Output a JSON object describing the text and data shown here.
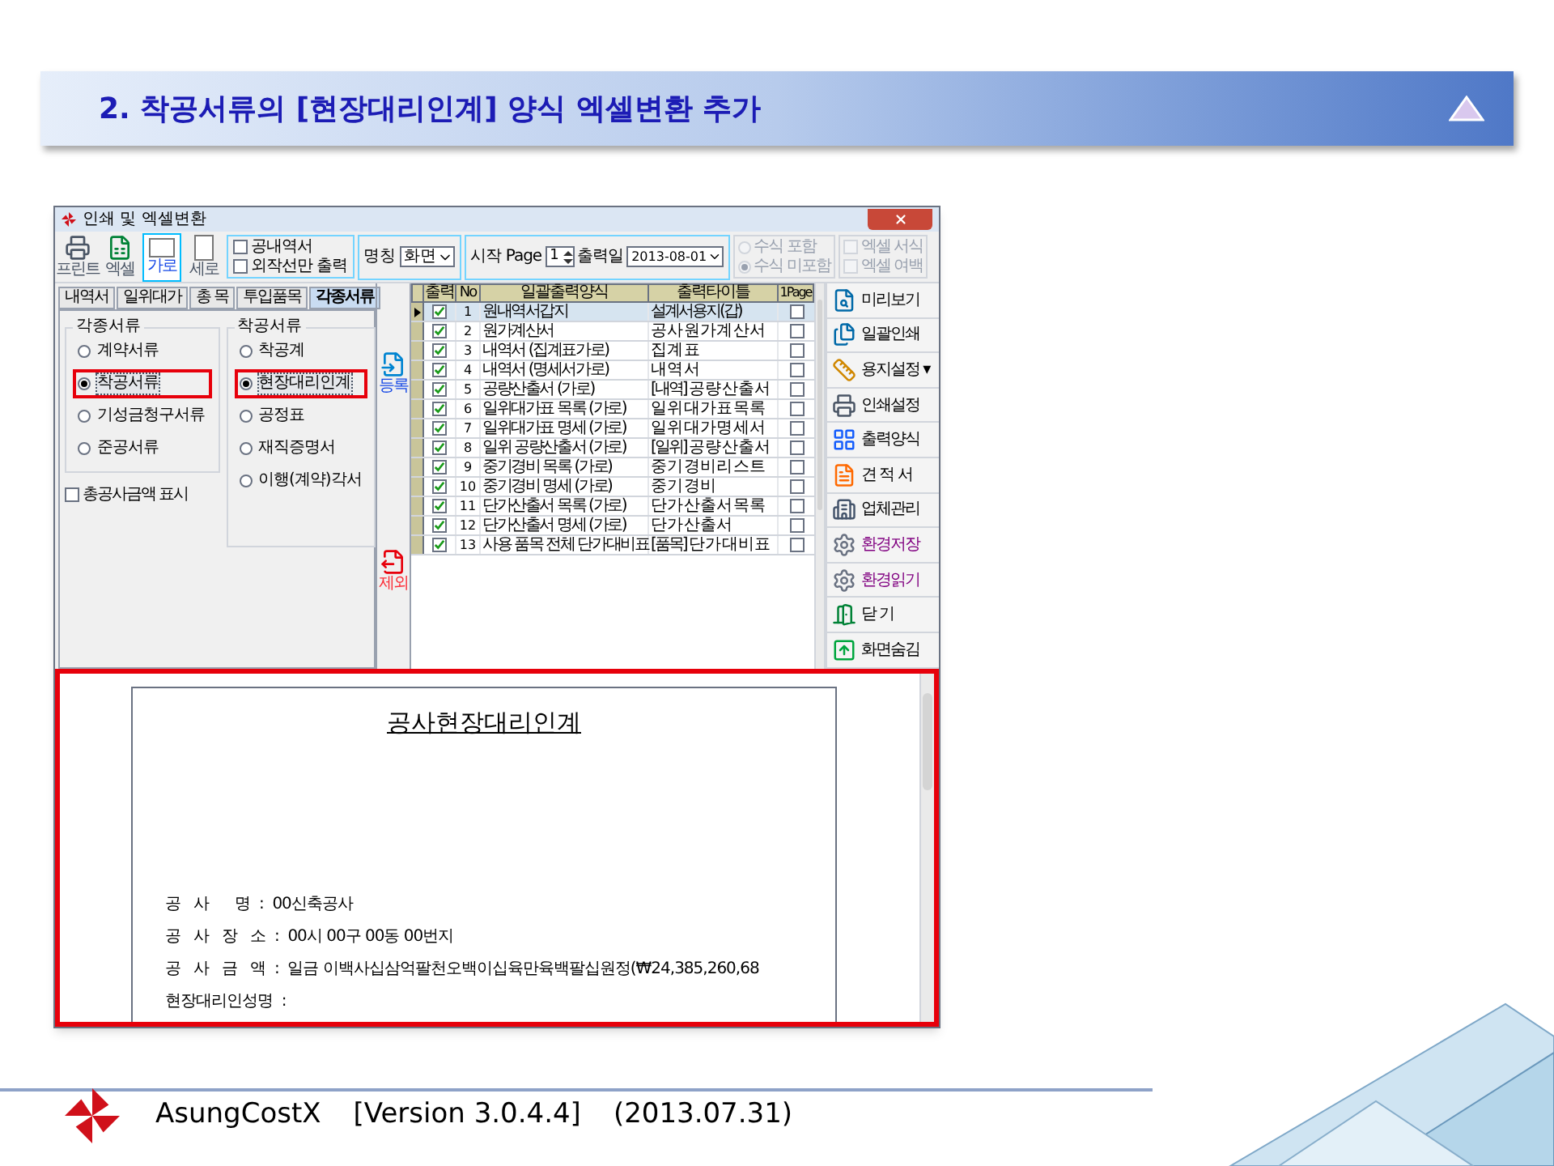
{
  "slide": {
    "title": "2. 착공서류의 [현장대리인계] 양식 엑셀변환 추가"
  },
  "window": {
    "title": "인쇄 및 엑셀변환"
  },
  "toolbar": {
    "buttons": [
      {
        "label": "프린트",
        "kind": "print",
        "selected": false
      },
      {
        "label": "엑셀",
        "kind": "excel",
        "selected": false
      },
      {
        "label": "가로",
        "kind": "landscape",
        "selected": true
      },
      {
        "label": "세로",
        "kind": "portrait",
        "selected": false
      }
    ],
    "options": [
      {
        "label": "공내역서",
        "checked": false
      },
      {
        "label": "외작선만 출력",
        "checked": false
      }
    ],
    "name_field": {
      "label": "명칭",
      "value": "화면"
    },
    "start_page": {
      "label": "시작 Page",
      "value": "1"
    },
    "print_date": {
      "label": "출력일",
      "value": "2013-08-01"
    },
    "formula": [
      {
        "label": "수식 포함",
        "selected": false,
        "disabled": true
      },
      {
        "label": "수식 미포함",
        "selected": true,
        "disabled": true
      }
    ],
    "excel_options": [
      {
        "label": "엑셀 서식",
        "checked": false,
        "disabled": true
      },
      {
        "label": "엑셀 여백",
        "checked": false,
        "disabled": true
      }
    ]
  },
  "tabs": [
    {
      "label": "내역서",
      "selected": false
    },
    {
      "label": "일위대가",
      "selected": false
    },
    {
      "label": "총 목",
      "selected": false
    },
    {
      "label": "투입품목",
      "selected": false
    },
    {
      "label": "각종서류",
      "selected": true
    }
  ],
  "doc_types": {
    "title": "각종서류",
    "options": [
      {
        "label": "계약서류",
        "selected": false,
        "highlighted": false
      },
      {
        "label": "착공서류",
        "selected": true,
        "highlighted": true
      },
      {
        "label": "기성금청구서류",
        "selected": false,
        "highlighted": false
      },
      {
        "label": "준공서류",
        "selected": false,
        "highlighted": false
      }
    ]
  },
  "total_amount": {
    "label": "총공사금액 표시",
    "checked": false
  },
  "start_docs": {
    "title": "착공서류",
    "options": [
      {
        "label": "착공계",
        "selected": false,
        "highlighted": false
      },
      {
        "label": "현장대리인계",
        "selected": true,
        "highlighted": true
      },
      {
        "label": "공정표",
        "selected": false,
        "highlighted": false
      },
      {
        "label": "재직증명서",
        "selected": false,
        "highlighted": false
      },
      {
        "label": "이행(계약)각서",
        "selected": false,
        "highlighted": false
      }
    ]
  },
  "add_button": {
    "label": "등록"
  },
  "remove_button": {
    "label": "제외"
  },
  "table": {
    "columns": [
      "출력",
      "No",
      "일괄출력양식",
      "출력타이틀",
      "1Page"
    ],
    "rows": [
      {
        "print": true,
        "no": "1",
        "form": "원내역서갑지",
        "title": "설계서용지(갑)",
        "one_page": false,
        "selected": true
      },
      {
        "print": true,
        "no": "2",
        "form": "원가계산서",
        "title": "공 사 원 가 계 산 서",
        "one_page": false,
        "selected": false
      },
      {
        "print": true,
        "no": "3",
        "form": "내역서 (집계표가로)",
        "title": "집 계 표",
        "one_page": false,
        "selected": false
      },
      {
        "print": true,
        "no": "4",
        "form": "내역서 (명세서가로)",
        "title": "내 역 서",
        "one_page": false,
        "selected": false
      },
      {
        "print": true,
        "no": "5",
        "form": "공량산출서 (가로)",
        "title": "[내역] 공 량 산 출 서",
        "one_page": false,
        "selected": false
      },
      {
        "print": true,
        "no": "6",
        "form": "일위대가표 목록 (가로)",
        "title": "일 위 대 가 표 목 록",
        "one_page": false,
        "selected": false
      },
      {
        "print": true,
        "no": "7",
        "form": "일위대가표 명세 (가로)",
        "title": "일 위 대 가 명 세 서",
        "one_page": false,
        "selected": false
      },
      {
        "print": true,
        "no": "8",
        "form": "일위 공량산출서 (가로)",
        "title": "[일위] 공 량 산 출 서",
        "one_page": false,
        "selected": false
      },
      {
        "print": true,
        "no": "9",
        "form": "중기경비 목록 (가로)",
        "title": "중 기 경 비 리 스 트",
        "one_page": false,
        "selected": false
      },
      {
        "print": true,
        "no": "10",
        "form": "중기경비 명세 (가로)",
        "title": "중 기 경 비",
        "one_page": false,
        "selected": false
      },
      {
        "print": true,
        "no": "11",
        "form": "단가산출서 목록 (가로)",
        "title": "단 가 산 출 서 목 록",
        "one_page": false,
        "selected": false
      },
      {
        "print": true,
        "no": "12",
        "form": "단가산출서 명세 (가로)",
        "title": "단 가 산 출 서",
        "one_page": false,
        "selected": false
      },
      {
        "print": true,
        "no": "13",
        "form": "사용 품목 전체 단가대비표",
        "title": "[품목] 단 가 대 비 표",
        "one_page": false,
        "selected": false
      }
    ]
  },
  "side_buttons": [
    {
      "label": "미리보기",
      "kind": "preview",
      "color": "#000000"
    },
    {
      "label": "일괄인쇄",
      "kind": "batch",
      "color": "#000000"
    },
    {
      "label": "용지설정 ▾",
      "kind": "paper",
      "color": "#000000"
    },
    {
      "label": "인쇄설정",
      "kind": "printer",
      "color": "#000000"
    },
    {
      "label": "출력양식",
      "kind": "layout",
      "color": "#000000"
    },
    {
      "label": "견 적 서",
      "kind": "estimate",
      "color": "#000000"
    },
    {
      "label": "업체관리",
      "kind": "company",
      "color": "#000000"
    },
    {
      "label": "환경저장",
      "kind": "save_settings",
      "color": "#800080"
    },
    {
      "label": "환경읽기",
      "kind": "load_settings",
      "color": "#800080"
    },
    {
      "label": "닫 기",
      "kind": "close",
      "color": "#000000"
    },
    {
      "label": "화면숨김",
      "kind": "hide",
      "color": "#000000"
    }
  ],
  "preview": {
    "highlighted": true,
    "heading": "공사현장대리인계",
    "lines": [
      "공   사      명  :  00신축공사",
      "공   사   장   소  :  00시 00구 00동 00번지",
      "공   사   금   액  :  일금 이백사십삼억팔천오백이십육만육백팔십원정(₩24,385,260,68",
      "현장대리인성명  :"
    ]
  },
  "footer": {
    "product": "AsungCostX",
    "version": "[Version 3.0.4.4]",
    "date": "(2013.07.31)"
  }
}
